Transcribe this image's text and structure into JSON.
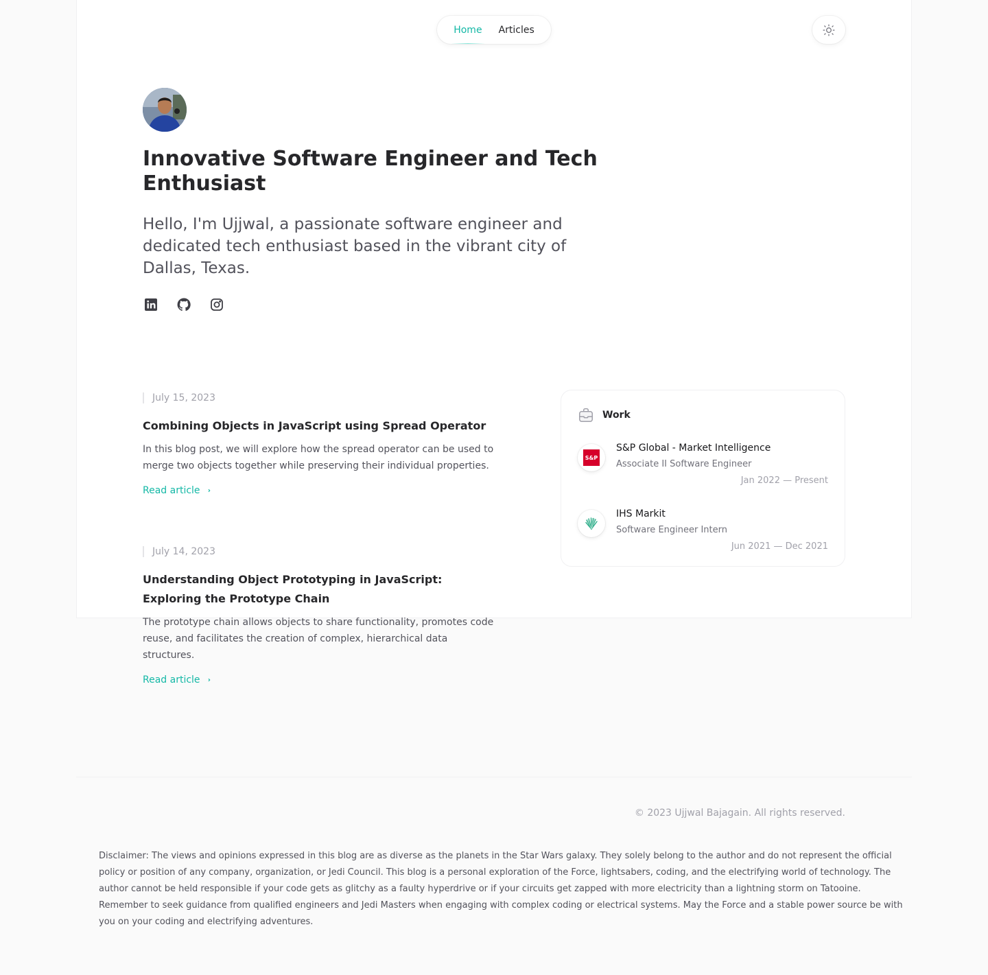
{
  "nav": {
    "items": [
      {
        "label": "Home",
        "active": true
      },
      {
        "label": "Articles",
        "active": false
      }
    ],
    "theme_icon": "sun-icon"
  },
  "hero": {
    "title": "Innovative Software Engineer and Tech Enthusiast",
    "intro": "Hello, I'm Ujjwal, a passionate software engineer and dedicated tech enthusiast based in the vibrant city of Dallas, Texas.",
    "socials": [
      "linkedin-icon",
      "github-icon",
      "instagram-icon"
    ]
  },
  "articles": [
    {
      "date": "July 15, 2023",
      "title": "Combining Objects in JavaScript using Spread Operator",
      "summary": "In this blog post, we will explore how the spread operator can be used to merge two objects together while preserving their individual properties.",
      "cta": "Read article"
    },
    {
      "date": "July 14, 2023",
      "title": "Understanding Object Prototyping in JavaScript: Exploring the Prototype Chain",
      "summary": "The prototype chain allows objects to share functionality, promotes code reuse, and facilitates the creation of complex, hierarchical data structures.",
      "cta": "Read article"
    }
  ],
  "work": {
    "heading": "Work",
    "jobs": [
      {
        "company": "S&P Global - Market Intelligence",
        "role": "Associate II Software Engineer",
        "dates": "Jan 2022 — Present",
        "logo_text": "S&P"
      },
      {
        "company": "IHS Markit",
        "role": "Software Engineer Intern",
        "dates": "Jun 2021 — Dec 2021"
      }
    ]
  },
  "footer": {
    "copyright": "© 2023 Ujjwal Bajagain. All rights reserved.",
    "disclaimer": "Disclaimer: The views and opinions expressed in this blog are as diverse as the planets in the Star Wars galaxy. They solely belong to the author and do not represent the official policy or position of any company, organization, or Jedi Council. This blog is a personal exploration of the Force, lightsabers, coding, and the electrifying world of technology. The author cannot be held responsible if your code gets as glitchy as a faulty hyperdrive or if your circuits get zapped with more electricity than a lightning storm on Tatooine. Remember to seek guidance from qualified engineers and Jedi Masters when engaging with complex coding or electrical systems. May the Force and a stable power source be with you on your coding and electrifying adventures."
  },
  "colors": {
    "accent": "#14b8a6",
    "text": "#27272a",
    "muted": "#a1a1aa",
    "sp_red": "#d6002a"
  }
}
